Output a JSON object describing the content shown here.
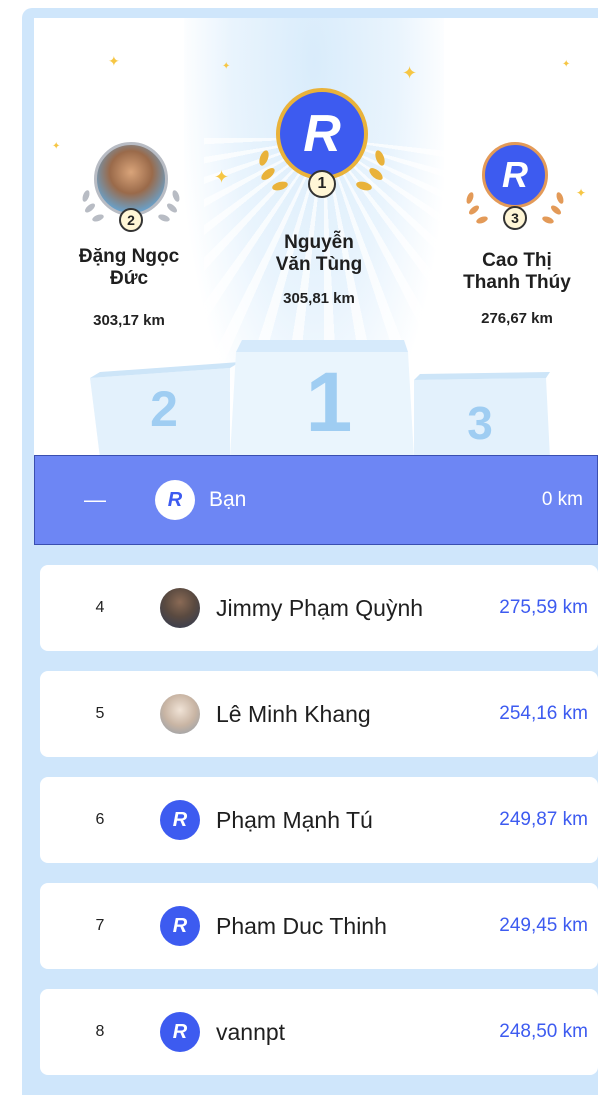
{
  "podium": {
    "first": {
      "rank": "1",
      "name_line1": "Nguyễn",
      "name_line2": "Văn Tùng",
      "km": "305,81 km",
      "avatar_icon": "r-logo-icon"
    },
    "second": {
      "rank": "2",
      "name_line1": "Đặng Ngọc",
      "name_line2": "Đức",
      "km": "303,17 km",
      "avatar_icon": "user-photo"
    },
    "third": {
      "rank": "3",
      "name_line1": "Cao Thị",
      "name_line2": "Thanh Thúy",
      "km": "276,67 km",
      "avatar_icon": "r-logo-icon"
    },
    "stand_numbers": [
      "2",
      "1",
      "3"
    ]
  },
  "me": {
    "rank": "—",
    "name": "Bạn",
    "km": "0 km",
    "avatar_icon": "r-logo-icon"
  },
  "leaderboard": [
    {
      "rank": "4",
      "name": "Jimmy Phạm Quỳnh",
      "km": "275,59 km",
      "avatar": "photo"
    },
    {
      "rank": "5",
      "name": "Lê Minh Khang",
      "km": "254,16 km",
      "avatar": "photo"
    },
    {
      "rank": "6",
      "name": "Phạm Mạnh Tú",
      "km": "249,87 km",
      "avatar": "r-logo"
    },
    {
      "rank": "7",
      "name": "Pham Duc Thinh",
      "km": "249,45 km",
      "avatar": "r-logo"
    },
    {
      "rank": "8",
      "name": "vannpt",
      "km": "248,50 km",
      "avatar": "r-logo"
    }
  ],
  "logo_letter": "R",
  "colors": {
    "accent": "#3d5bf0",
    "me_row": "#6d86f4",
    "frame": "#cfe6fb",
    "gold": "#e9b23a",
    "silver": "#b8bcc4",
    "bronze": "#e39a58"
  }
}
